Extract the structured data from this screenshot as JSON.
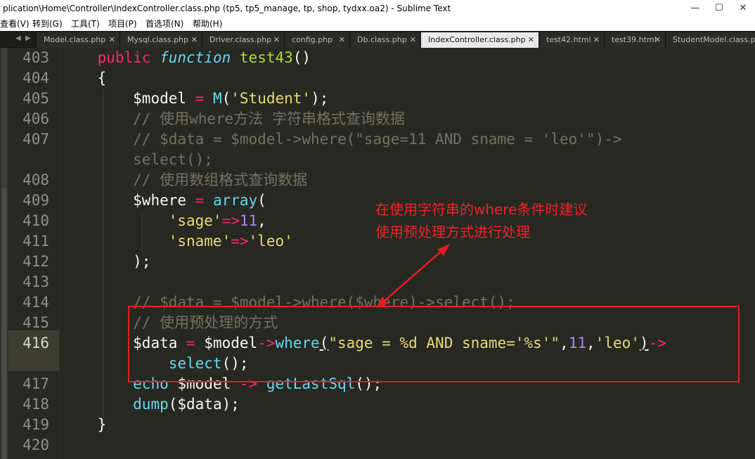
{
  "window": {
    "title": "plication\\Home\\Controller\\IndexController.class.php (tp5, tp5_manage, tp, shop, tydxx.oa2) - Sublime Text",
    "controls": [
      "—",
      "☐",
      "✕"
    ]
  },
  "menu": [
    "查看(V)",
    "转到(G)",
    "工具(T)",
    "项目(P)",
    "首选项(N)",
    "帮助(H)"
  ],
  "tabs": [
    {
      "label": "Model.class.php",
      "active": false
    },
    {
      "label": "Mysql.class.php",
      "active": false
    },
    {
      "label": "Driver.class.php",
      "active": false
    },
    {
      "label": "config.php",
      "active": false
    },
    {
      "label": "Db.class.php",
      "active": false
    },
    {
      "label": "IndexController.class.php",
      "active": true
    },
    {
      "label": "test42.html",
      "active": false
    },
    {
      "label": "test39.html",
      "active": false
    },
    {
      "label": "StudentModel.class.php",
      "active": false
    }
  ],
  "editor": {
    "line_numbers": [
      "403",
      "404",
      "405",
      "406",
      "407",
      "",
      "408",
      "409",
      "410",
      "411",
      "412",
      "413",
      "414",
      "415",
      "416",
      "",
      "417",
      "418",
      "419",
      "420"
    ],
    "current_line": "416",
    "code": {
      "l403_kw": "public",
      "l403_fn": "function",
      "l403_name": "test43",
      "l403_paren": "()",
      "l404": "{",
      "l405_var": "$model",
      "l405_eq": " = ",
      "l405_call": "M",
      "l405_p1": "(",
      "l405_str": "'Student'",
      "l405_p2": ");",
      "l406_cmt": "// 使用where方法 字符串格式查询数据",
      "l407_cmt": "// $data = $model->where(\"sage=11 AND sname = 'leo'\")->",
      "l407b_cmt": "select();",
      "l408_cmt": "// 使用数组格式查询数据",
      "l409_var": "$where",
      "l409_eq": " = ",
      "l409_call": "array",
      "l409_p": "(",
      "l410_str": "'sage'",
      "l410_op": "=>",
      "l410_num": "11",
      "l410_c": ",",
      "l411_str": "'sname'",
      "l411_op": "=>",
      "l411_str2": "'leo'",
      "l412": ");",
      "l414_cmt": "// $data = $model->where($where)->select();",
      "l415_cmt": "// 使用预处理的方式",
      "l416_var": "$data",
      "l416_eq": " = ",
      "l416_var2": "$model",
      "l416_arrow": "->",
      "l416_call": "where",
      "l416_p": "(",
      "l416_str": "\"sage = %d AND sname='%s'\"",
      "l416_c1": ",",
      "l416_num": "11",
      "l416_c2": ",",
      "l416_str2": "'leo'",
      "l416_p2": ")",
      "l416_arrow2": "->",
      "l416b_call": "select",
      "l416b_p": "();",
      "l417_call": "echo",
      "l417_var": " $model ",
      "l417_arrow": "->",
      "l417_call2": " getLastSql",
      "l417_p": "();",
      "l418_call": "dump",
      "l418_p": "($data);",
      "l419": "}"
    }
  },
  "annotation": {
    "line1": "在使用字符串的where条件时建议",
    "line2": "使用预处理方式进行处理",
    "color": "#e21e23"
  },
  "theme": {
    "background": "#272822",
    "keyword": "#f92672",
    "function": "#66d9ef",
    "string": "#e6db74",
    "number": "#ae81ff",
    "comment": "#75715e",
    "name": "#a6e22e"
  }
}
